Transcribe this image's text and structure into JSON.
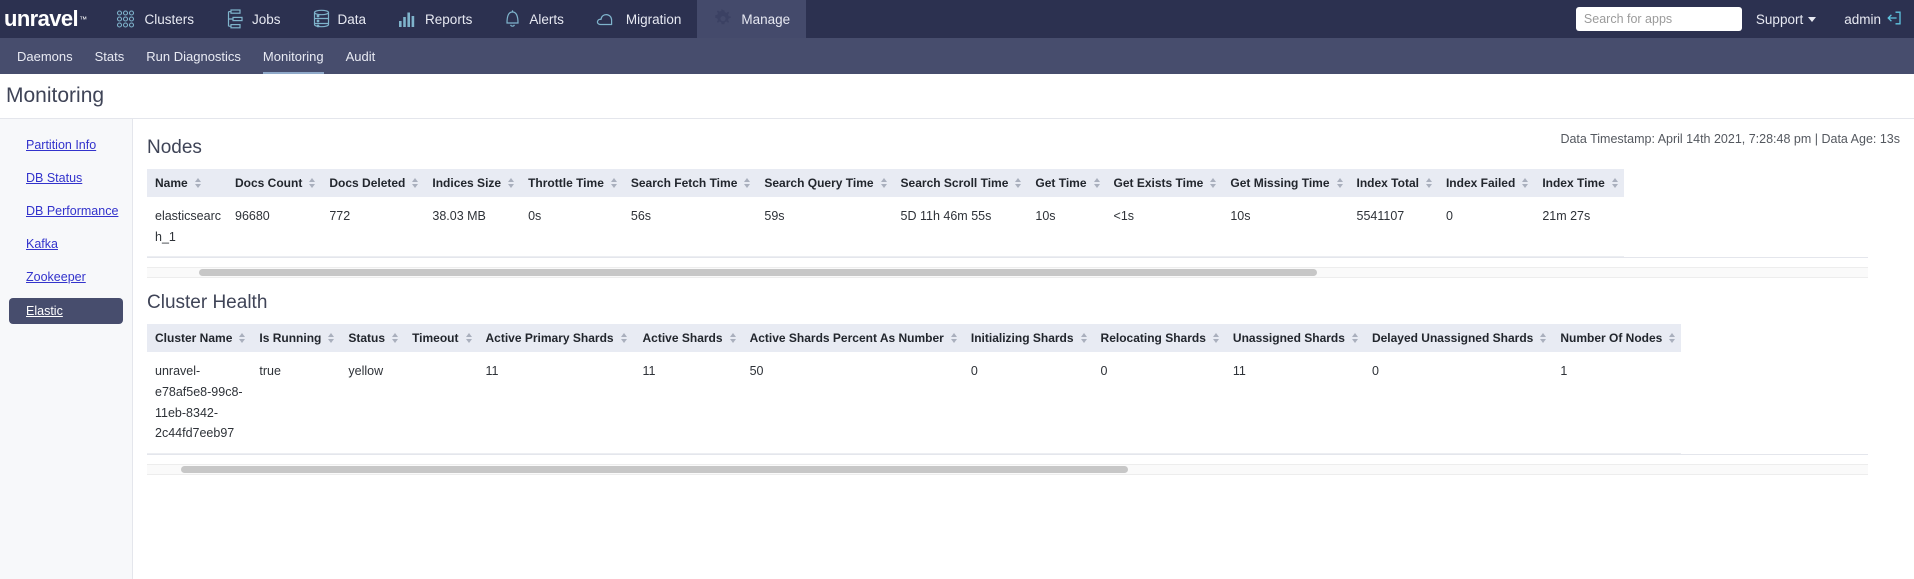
{
  "topnav": {
    "brand": "unravel",
    "brand_tm": "™",
    "items": [
      {
        "label": "Clusters",
        "icon": "clusters-icon",
        "active": false
      },
      {
        "label": "Jobs",
        "icon": "jobs-icon",
        "active": false
      },
      {
        "label": "Data",
        "icon": "data-icon",
        "active": false
      },
      {
        "label": "Reports",
        "icon": "reports-icon",
        "active": false
      },
      {
        "label": "Alerts",
        "icon": "alerts-bell-icon",
        "active": false
      },
      {
        "label": "Migration",
        "icon": "migration-cloud-icon",
        "active": false
      },
      {
        "label": "Manage",
        "icon": "gear-icon",
        "active": true
      }
    ],
    "search_placeholder": "Search for apps",
    "support_label": "Support",
    "user_label": "admin"
  },
  "subnav": {
    "items": [
      {
        "label": "Daemons",
        "active": false
      },
      {
        "label": "Stats",
        "active": false
      },
      {
        "label": "Run Diagnostics",
        "active": false
      },
      {
        "label": "Monitoring",
        "active": true
      },
      {
        "label": "Audit",
        "active": false
      }
    ]
  },
  "page": {
    "title": "Monitoring",
    "timestamp": "Data Timestamp: April 14th 2021, 7:28:48 pm | Data Age: 13s"
  },
  "leftrail": {
    "items": [
      {
        "label": "Partition Info",
        "active": false
      },
      {
        "label": "DB Status",
        "active": false
      },
      {
        "label": "DB Performance",
        "active": false
      },
      {
        "label": "Kafka",
        "active": false
      },
      {
        "label": "Zookeeper",
        "active": false
      },
      {
        "label": "Elastic",
        "active": true
      }
    ]
  },
  "nodes": {
    "title": "Nodes",
    "columns": [
      "Name",
      "Docs Count",
      "Docs Deleted",
      "Indices Size",
      "Throttle Time",
      "Search Fetch Time",
      "Search Query Time",
      "Search Scroll Time",
      "Get Time",
      "Get Exists Time",
      "Get Missing Time",
      "Index Total",
      "Index Failed",
      "Index Time"
    ],
    "rows": [
      [
        "elasticsearch_1",
        "96680",
        "772",
        "38.03 MB",
        "0s",
        "56s",
        "59s",
        "5D 11h 46m 55s",
        "10s",
        "<1s",
        "10s",
        "5541107",
        "0",
        "21m 27s"
      ]
    ],
    "scroll_thumb_left_pct": 3,
    "scroll_thumb_width_pct": 65
  },
  "cluster_health": {
    "title": "Cluster Health",
    "columns": [
      "Cluster Name",
      "Is Running",
      "Status",
      "Timeout",
      "Active Primary Shards",
      "Active Shards",
      "Active Shards Percent As Number",
      "Initializing Shards",
      "Relocating Shards",
      "Unassigned Shards",
      "Delayed Unassigned Shards",
      "Number Of Nodes"
    ],
    "rows": [
      [
        "unravel-e78af5e8-99c8-11eb-8342-2c44fd7eeb97",
        "true",
        "yellow",
        "",
        "11",
        "11",
        "50",
        "0",
        "0",
        "11",
        "0",
        "1"
      ]
    ],
    "scroll_thumb_left_pct": 2,
    "scroll_thumb_width_pct": 55
  },
  "colors": {
    "topbar_bg": "#2c3150",
    "subnav_bg": "#474d6d",
    "active_nav_bg": "#444a6b",
    "link_blue": "#3333cc",
    "table_header_bg": "#e8ebf3",
    "icon_teal": "#7fb4cc"
  }
}
